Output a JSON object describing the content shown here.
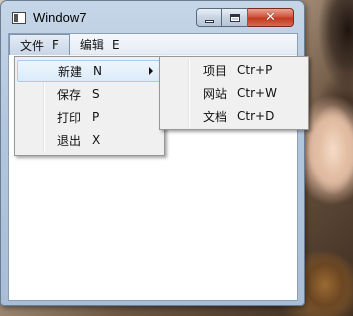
{
  "window": {
    "title": "Window7"
  },
  "menubar": {
    "items": [
      {
        "label": "文件",
        "key": "F"
      },
      {
        "label": "编辑",
        "key": "E"
      }
    ]
  },
  "file_menu": {
    "items": [
      {
        "label": "新建",
        "key": "N",
        "has_submenu": true
      },
      {
        "label": "保存",
        "key": "S"
      },
      {
        "label": "打印",
        "key": "P"
      },
      {
        "label": "退出",
        "key": "X"
      }
    ]
  },
  "new_submenu": {
    "items": [
      {
        "label": "项目",
        "shortcut": "Ctr+P"
      },
      {
        "label": "网站",
        "shortcut": "Ctr+W"
      },
      {
        "label": "文档",
        "shortcut": "Ctr+D"
      }
    ]
  },
  "icons": {
    "app": "window-app-icon",
    "minimize": "minimize-icon",
    "maximize": "maximize-icon",
    "close": "close-icon",
    "submenu": "chevron-right-icon"
  },
  "colors": {
    "close_button": "#c8472c",
    "highlight_border": "#a8cdf0"
  }
}
